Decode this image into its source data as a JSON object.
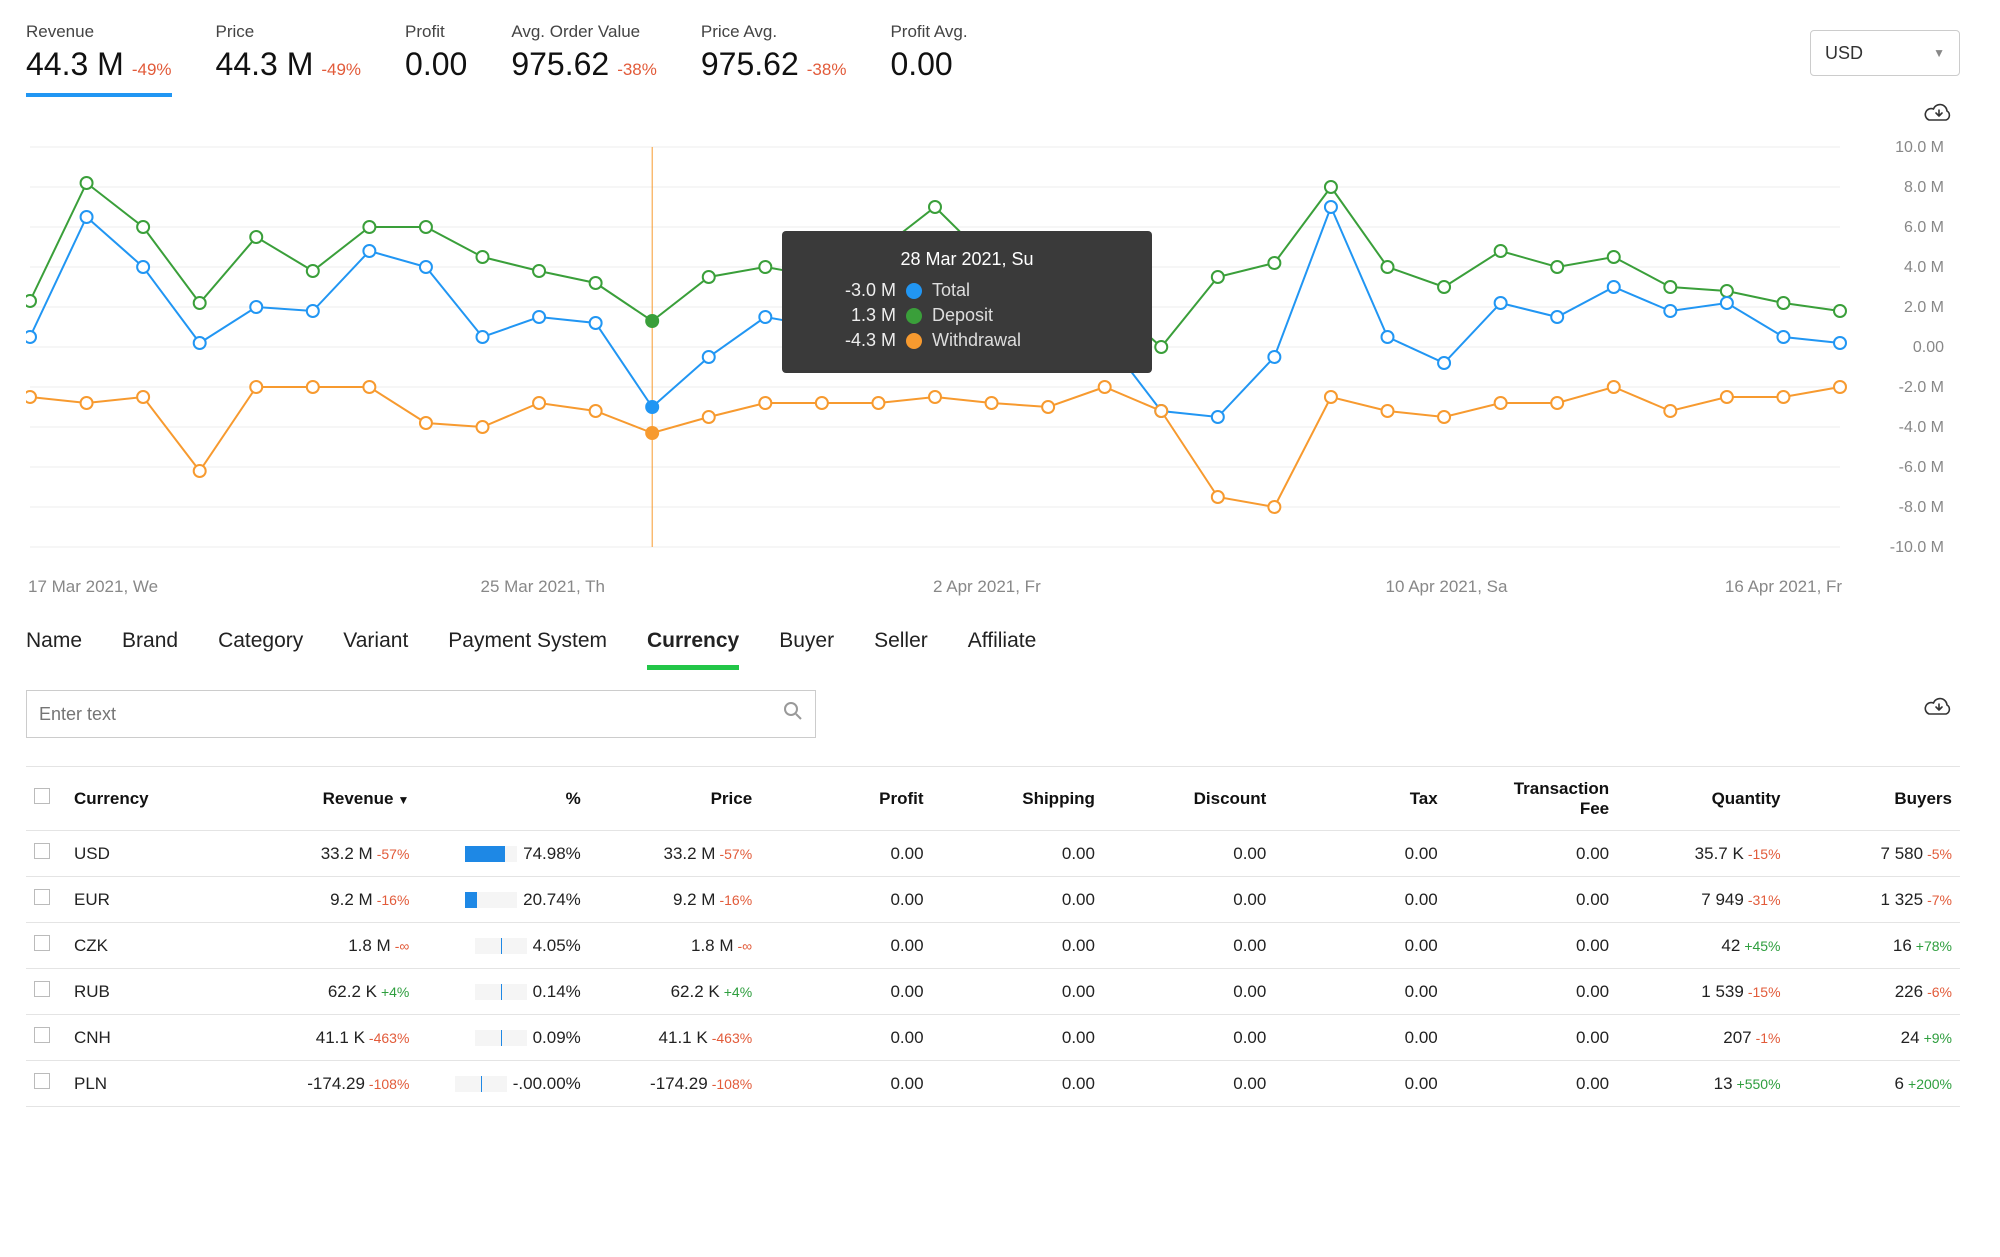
{
  "currency_selector": {
    "value": "USD"
  },
  "kpis": [
    {
      "label": "Revenue",
      "value": "44.3 M",
      "delta": "-49%",
      "dir": "neg",
      "active": true
    },
    {
      "label": "Price",
      "value": "44.3 M",
      "delta": "-49%",
      "dir": "neg",
      "active": false
    },
    {
      "label": "Profit",
      "value": "0.00",
      "delta": "",
      "dir": "",
      "active": false
    },
    {
      "label": "Avg. Order Value",
      "value": "975.62",
      "delta": "-38%",
      "dir": "neg",
      "active": false
    },
    {
      "label": "Price Avg.",
      "value": "975.62",
      "delta": "-38%",
      "dir": "neg",
      "active": false
    },
    {
      "label": "Profit Avg.",
      "value": "0.00",
      "delta": "",
      "dir": "",
      "active": false
    }
  ],
  "search": {
    "placeholder": "Enter text"
  },
  "filter_tabs": [
    "Name",
    "Brand",
    "Category",
    "Variant",
    "Payment System",
    "Currency",
    "Buyer",
    "Seller",
    "Affiliate"
  ],
  "filter_active": "Currency",
  "table": {
    "headers": [
      "",
      "Currency",
      "Revenue",
      "%",
      "Price",
      "Profit",
      "Shipping",
      "Discount",
      "Tax",
      "Transaction Fee",
      "Quantity",
      "Buyers"
    ],
    "sort_col": "Revenue",
    "rows": [
      {
        "currency": "USD",
        "revenue": "33.2 M",
        "revenue_d": "-57%",
        "revenue_dir": "neg",
        "pct": "74.98%",
        "pct_w": 40,
        "price": "33.2 M",
        "price_d": "-57%",
        "price_dir": "neg",
        "profit": "0.00",
        "ship": "0.00",
        "disc": "0.00",
        "tax": "0.00",
        "fee": "0.00",
        "qty": "35.7 K",
        "qty_d": "-15%",
        "qty_dir": "neg",
        "buyers": "7 580",
        "buyers_d": "-5%",
        "buyers_dir": "neg"
      },
      {
        "currency": "EUR",
        "revenue": "9.2 M",
        "revenue_d": "-16%",
        "revenue_dir": "neg",
        "pct": "20.74%",
        "pct_w": 12,
        "price": "9.2 M",
        "price_d": "-16%",
        "price_dir": "neg",
        "profit": "0.00",
        "ship": "0.00",
        "disc": "0.00",
        "tax": "0.00",
        "fee": "0.00",
        "qty": "7 949",
        "qty_d": "-31%",
        "qty_dir": "neg",
        "buyers": "1 325",
        "buyers_d": "-7%",
        "buyers_dir": "neg"
      },
      {
        "currency": "CZK",
        "revenue": "1.8 M",
        "revenue_d": "-∞",
        "revenue_dir": "neg",
        "pct": "4.05%",
        "pct_w": 0,
        "price": "1.8 M",
        "price_d": "-∞",
        "price_dir": "neg",
        "profit": "0.00",
        "ship": "0.00",
        "disc": "0.00",
        "tax": "0.00",
        "fee": "0.00",
        "qty": "42",
        "qty_d": "+45%",
        "qty_dir": "pos",
        "buyers": "16",
        "buyers_d": "+78%",
        "buyers_dir": "pos"
      },
      {
        "currency": "RUB",
        "revenue": "62.2 K",
        "revenue_d": "+4%",
        "revenue_dir": "pos",
        "pct": "0.14%",
        "pct_w": 0,
        "price": "62.2 K",
        "price_d": "+4%",
        "price_dir": "pos",
        "profit": "0.00",
        "ship": "0.00",
        "disc": "0.00",
        "tax": "0.00",
        "fee": "0.00",
        "qty": "1 539",
        "qty_d": "-15%",
        "qty_dir": "neg",
        "buyers": "226",
        "buyers_d": "-6%",
        "buyers_dir": "neg"
      },
      {
        "currency": "CNH",
        "revenue": "41.1 K",
        "revenue_d": "-463%",
        "revenue_dir": "neg",
        "pct": "0.09%",
        "pct_w": 0,
        "price": "41.1 K",
        "price_d": "-463%",
        "price_dir": "neg",
        "profit": "0.00",
        "ship": "0.00",
        "disc": "0.00",
        "tax": "0.00",
        "fee": "0.00",
        "qty": "207",
        "qty_d": "-1%",
        "qty_dir": "neg",
        "buyers": "24",
        "buyers_d": "+9%",
        "buyers_dir": "pos"
      },
      {
        "currency": "PLN",
        "revenue": "-174.29",
        "revenue_d": "-108%",
        "revenue_dir": "neg",
        "pct": "-.00.00%",
        "pct_w": 0,
        "price": "-174.29",
        "price_d": "-108%",
        "price_dir": "neg",
        "profit": "0.00",
        "ship": "0.00",
        "disc": "0.00",
        "tax": "0.00",
        "fee": "0.00",
        "qty": "13",
        "qty_d": "+550%",
        "qty_dir": "pos",
        "buyers": "6",
        "buyers_d": "+200%",
        "buyers_dir": "pos"
      }
    ]
  },
  "chart_tooltip": {
    "title": "28 Mar 2021, Su",
    "rows": [
      {
        "value": "-3.0 M",
        "color": "#2196f3",
        "name": "Total"
      },
      {
        "value": "1.3 M",
        "color": "#3a9f3a",
        "name": "Deposit"
      },
      {
        "value": "-4.3 M",
        "color": "#f79a2f",
        "name": "Withdrawal"
      }
    ]
  },
  "chart_data": {
    "type": "line",
    "title": "",
    "xlabel": "",
    "ylabel": "",
    "ylim": [
      -10.0,
      10.0
    ],
    "y_ticks": [
      "10.0 M",
      "8.0 M",
      "6.0 M",
      "4.0 M",
      "2.0 M",
      "0.00",
      "-2.0 M",
      "-4.0 M",
      "-6.0 M",
      "-8.0 M",
      "-10.0 M"
    ],
    "x_ticks": [
      {
        "label": "17 Mar 2021, We",
        "idx": 0
      },
      {
        "label": "25 Mar 2021, Th",
        "idx": 8
      },
      {
        "label": "2 Apr 2021, Fr",
        "idx": 16
      },
      {
        "label": "10 Apr 2021, Sa",
        "idx": 24
      },
      {
        "label": "16 Apr 2021, Fr",
        "idx": 30
      }
    ],
    "highlight_idx": 11,
    "series": [
      {
        "name": "Deposit",
        "color": "#3a9f3a",
        "values": [
          2.3,
          8.2,
          6.0,
          2.2,
          5.5,
          3.8,
          6.0,
          6.0,
          4.5,
          3.8,
          3.2,
          1.3,
          3.5,
          4.0,
          3.5,
          4.8,
          7.0,
          4.2,
          2.0,
          2.5,
          0.0,
          3.5,
          4.2,
          8.0,
          4.0,
          3.0,
          4.8,
          4.0,
          4.5,
          3.0,
          2.8,
          2.2,
          1.8
        ]
      },
      {
        "name": "Total",
        "color": "#2196f3",
        "values": [
          0.5,
          6.5,
          4.0,
          0.2,
          2.0,
          1.8,
          4.8,
          4.0,
          0.5,
          1.5,
          1.2,
          -3.0,
          -0.5,
          1.5,
          1.0,
          2.5,
          4.3,
          1.5,
          -0.5,
          0.5,
          -3.2,
          -3.5,
          -0.5,
          7.0,
          0.5,
          -0.8,
          2.2,
          1.5,
          3.0,
          1.8,
          2.2,
          0.5,
          0.2
        ]
      },
      {
        "name": "Withdrawal",
        "color": "#f79a2f",
        "values": [
          -2.5,
          -2.8,
          -2.5,
          -6.2,
          -2.0,
          -2.0,
          -2.0,
          -3.8,
          -4.0,
          -2.8,
          -3.2,
          -4.3,
          -3.5,
          -2.8,
          -2.8,
          -2.8,
          -2.5,
          -2.8,
          -3.0,
          -2.0,
          -3.2,
          -7.5,
          -8.0,
          -2.5,
          -3.2,
          -3.5,
          -2.8,
          -2.8,
          -2.0,
          -3.2,
          -2.5,
          -2.5,
          -2.0
        ]
      }
    ]
  }
}
